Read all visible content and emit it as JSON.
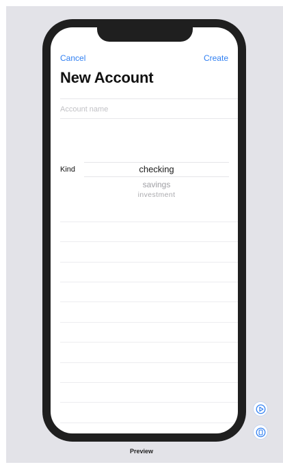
{
  "nav": {
    "cancel_label": "Cancel",
    "create_label": "Create"
  },
  "page_title": "New Account",
  "account_name_field": {
    "value": "",
    "placeholder": "Account name"
  },
  "kind_picker": {
    "label": "Kind",
    "options": [
      "checking",
      "savings",
      "investment"
    ],
    "selected_index": 0
  },
  "preview_label": "Preview",
  "accent_color": "#2f7ff2",
  "icons": {
    "play_button": "play-circle-icon",
    "device_button": "device-icon"
  }
}
